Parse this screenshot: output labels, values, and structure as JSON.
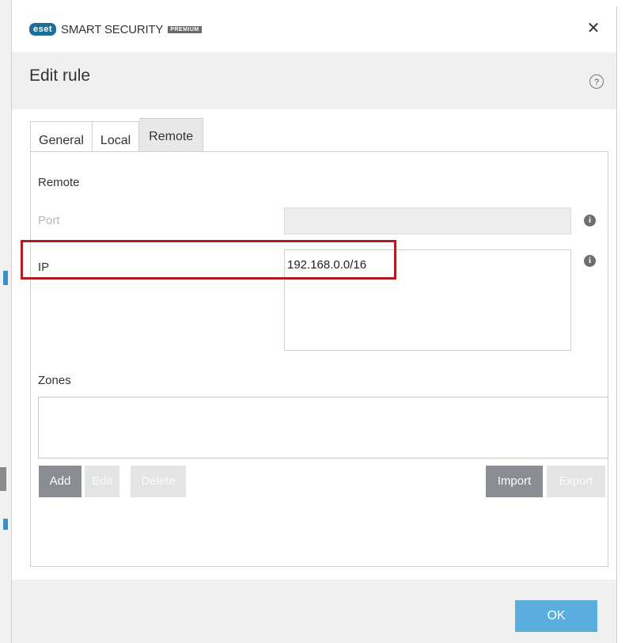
{
  "app": {
    "brand_badge": "eset",
    "product_name": "SMART SECURITY",
    "product_tier": "PREMIUM",
    "close_symbol": "✕"
  },
  "header": {
    "title": "Edit rule",
    "help_symbol": "?"
  },
  "tabs": [
    {
      "label": "General",
      "active": false
    },
    {
      "label": "Local",
      "active": false
    },
    {
      "label": "Remote",
      "active": true
    }
  ],
  "remote": {
    "section_label": "Remote",
    "port_label": "Port",
    "port_value": "",
    "ip_label": "IP",
    "ip_value": "192.168.0.0/16",
    "info_symbol": "i"
  },
  "zones": {
    "label": "Zones",
    "buttons": {
      "add": "Add",
      "edit": "Edit",
      "delete": "Delete",
      "import": "Import",
      "export": "Export"
    }
  },
  "footer": {
    "ok_label": "OK"
  },
  "colors": {
    "brand": "#1d6f99",
    "highlight": "#b01c22",
    "ok_button": "#5aaede",
    "enabled_button": "#8a8d92"
  }
}
